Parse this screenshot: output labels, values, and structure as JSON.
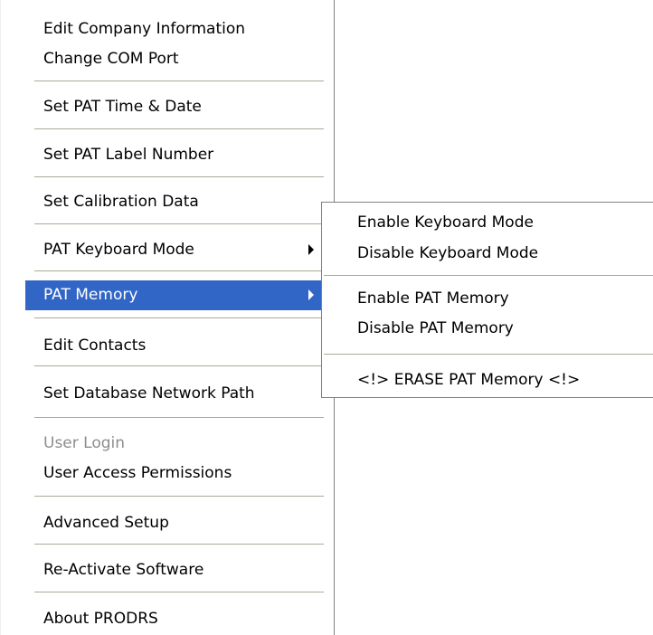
{
  "main_menu": {
    "items": [
      {
        "label": "Edit Company Information",
        "enabled": true
      },
      {
        "label": "Change COM Port",
        "enabled": true
      },
      {
        "label": "Set PAT Time & Date",
        "enabled": true
      },
      {
        "label": "Set PAT Label Number",
        "enabled": true
      },
      {
        "label": "Set Calibration Data",
        "enabled": true
      },
      {
        "label": "PAT Keyboard Mode",
        "enabled": true,
        "has_submenu": true
      },
      {
        "label": "PAT Memory",
        "enabled": true,
        "has_submenu": true,
        "highlighted": true
      },
      {
        "label": "Edit Contacts",
        "enabled": true
      },
      {
        "label": "Set Database Network Path",
        "enabled": true
      },
      {
        "label": "User Login",
        "enabled": false
      },
      {
        "label": "User Access Permissions",
        "enabled": true
      },
      {
        "label": "Advanced Setup",
        "enabled": true
      },
      {
        "label": "Re-Activate Software",
        "enabled": true
      },
      {
        "label": "About PRODRS",
        "enabled": true
      }
    ]
  },
  "sub_menu": {
    "items": [
      {
        "label": "Enable Keyboard Mode"
      },
      {
        "label": "Disable Keyboard Mode"
      },
      {
        "label": "Enable PAT Memory"
      },
      {
        "label": "Disable PAT Memory"
      },
      {
        "label": "<!> ERASE PAT Memory <!>"
      }
    ]
  },
  "colors": {
    "highlight_bg": "#3165c6",
    "highlight_text": "#ffffff",
    "disabled_text": "#8d8d8d",
    "separator": "#aca899"
  }
}
